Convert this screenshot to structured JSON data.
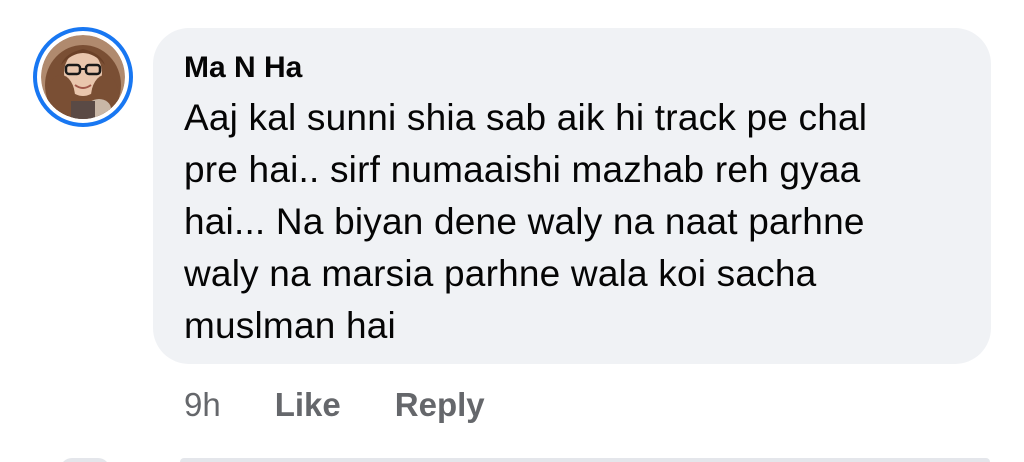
{
  "comment": {
    "author": "Ma N Ha",
    "text_lines": [
      "Aaj kal sunni shia sab aik hi track pe chal",
      "pre hai.. sirf numaaishi mazhab reh gyaa",
      "hai... Na biyan dene waly na naat parhne",
      "waly na marsia parhne wala koi sacha",
      "muslman hai"
    ],
    "time": "9h",
    "like_label": "Like",
    "reply_label": "Reply"
  },
  "colors": {
    "accent": "#1877f2",
    "bubble_bg": "#f0f2f5",
    "text": "#050505",
    "meta": "#65676b"
  },
  "icons": {
    "avatar": "profile-photo"
  }
}
